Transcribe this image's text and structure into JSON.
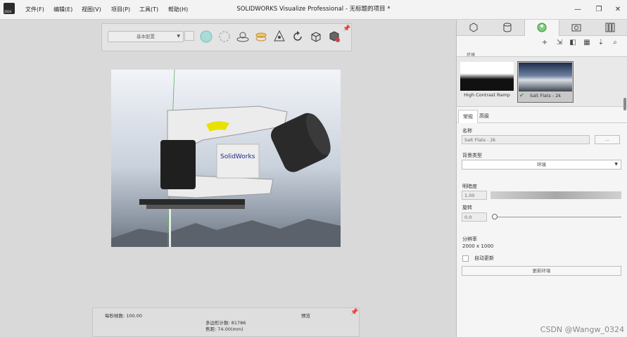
{
  "window": {
    "title": "SOLIDWORKS Visualize Professional - 无标题的项目 *",
    "app_icon_badge": "2024",
    "menu": [
      "文件(F)",
      "编辑(E)",
      "视图(V)",
      "项目(P)",
      "工具(T)",
      "帮助(H)"
    ],
    "controls": {
      "minimize": "—",
      "restore": "❐",
      "close": "✕"
    }
  },
  "toolbar": {
    "preset_dropdown": "基本配置",
    "icons": [
      "sphere-icon",
      "gear-disabled-icon",
      "turntable-icon",
      "floor-icon",
      "move-icon",
      "rotate-icon",
      "cube-icon",
      "render-tools-icon"
    ]
  },
  "viewport": {
    "model_logo_text": "SolidWorks"
  },
  "status": {
    "fps_label": "每秒帧数: 100.00",
    "preview_label": "预览",
    "polygon_count": "多边形计数: 81786",
    "focal_length": "焦距: 74.00(mm)"
  },
  "panel": {
    "tab_icons": [
      "models-icon",
      "appearances-icon",
      "scenes-icon",
      "cameras-icon",
      "libraries-icon"
    ],
    "active_tab": 2,
    "subtool_icons": [
      "add-icon",
      "import-icon",
      "split-view-icon",
      "grid-view-icon",
      "sort-icon",
      "search-icon"
    ],
    "section_label": "环境",
    "thumbnails": [
      {
        "caption": "High Contrast Ramp"
      },
      {
        "caption": "Salt Flats - 2k"
      }
    ],
    "prop_tabs": [
      "常规",
      "高级"
    ],
    "name_label": "名称",
    "name_value": "Salt Flats - 2k",
    "name_button": "...",
    "bg_type_label": "背景类型",
    "bg_type_value": "环境",
    "brightness_label": "明暗度",
    "brightness_value": "1.00",
    "rotation_label": "旋转",
    "rotation_value": "0.0",
    "resolution_label": "分辨率",
    "resolution_value": "2000 x 1000",
    "auto_update_label": "自动更新",
    "update_button": "更新环境"
  },
  "watermark": "CSDN @Wangw_0324"
}
